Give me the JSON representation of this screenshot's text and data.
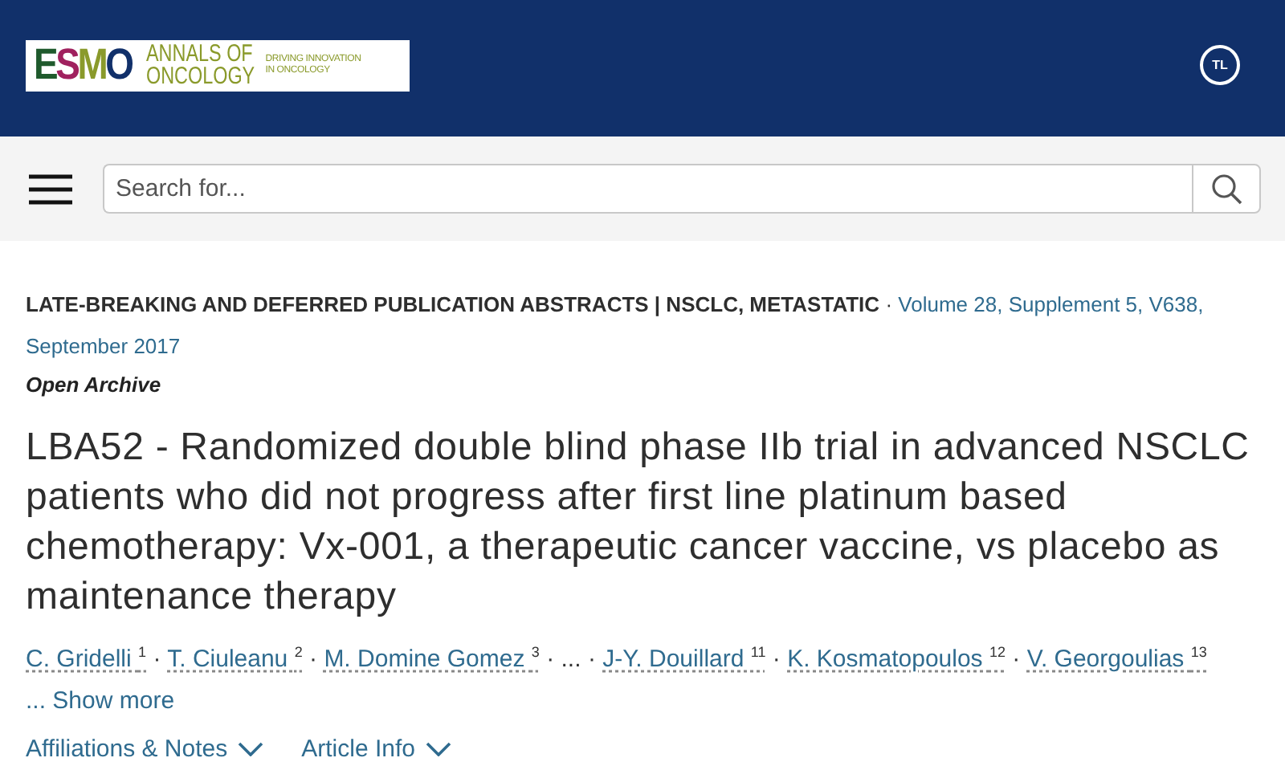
{
  "header": {
    "logo": {
      "mark": "ESMO",
      "name_lines": [
        "ANNALS OF",
        "ONCOLOGY"
      ],
      "tagline_lines": [
        "DRIVING INNOVATION",
        "IN ONCOLOGY"
      ]
    },
    "avatar": "TL"
  },
  "search": {
    "placeholder": "Search for..."
  },
  "article": {
    "section": "LATE-BREAKING AND DEFERRED PUBLICATION ABSTRACTS | NSCLC, METASTATIC",
    "separator": "·",
    "issue": "Volume 28, Supplement 5, V638, September 2017",
    "access": "Open Archive",
    "title": "LBA52 - Randomized double blind phase IIb trial in advanced NSCLC patients who did not progress after first line platinum based chemotherapy: Vx-001, a therapeutic cancer vaccine, vs placebo as maintenance therapy",
    "author_separator": "·",
    "authors": [
      {
        "kind": "author",
        "name": "C. Gridelli",
        "affiliation": "1"
      },
      {
        "kind": "author",
        "name": "T. Ciuleanu",
        "affiliation": "2"
      },
      {
        "kind": "author",
        "name": "M. Domine Gomez",
        "affiliation": "3"
      },
      {
        "kind": "ellipsis",
        "name": "..."
      },
      {
        "kind": "author",
        "name": "J-Y. Douillard",
        "affiliation": "11"
      },
      {
        "kind": "author",
        "name": "K. Kosmatopoulos",
        "affiliation": "12"
      },
      {
        "kind": "author",
        "name": "V. Georgoulias",
        "affiliation": "13"
      }
    ],
    "show_more": "... Show more",
    "toggles": [
      {
        "label": "Affiliations & Notes",
        "expanded": false
      },
      {
        "label": "Article Info",
        "expanded": false
      }
    ]
  }
}
